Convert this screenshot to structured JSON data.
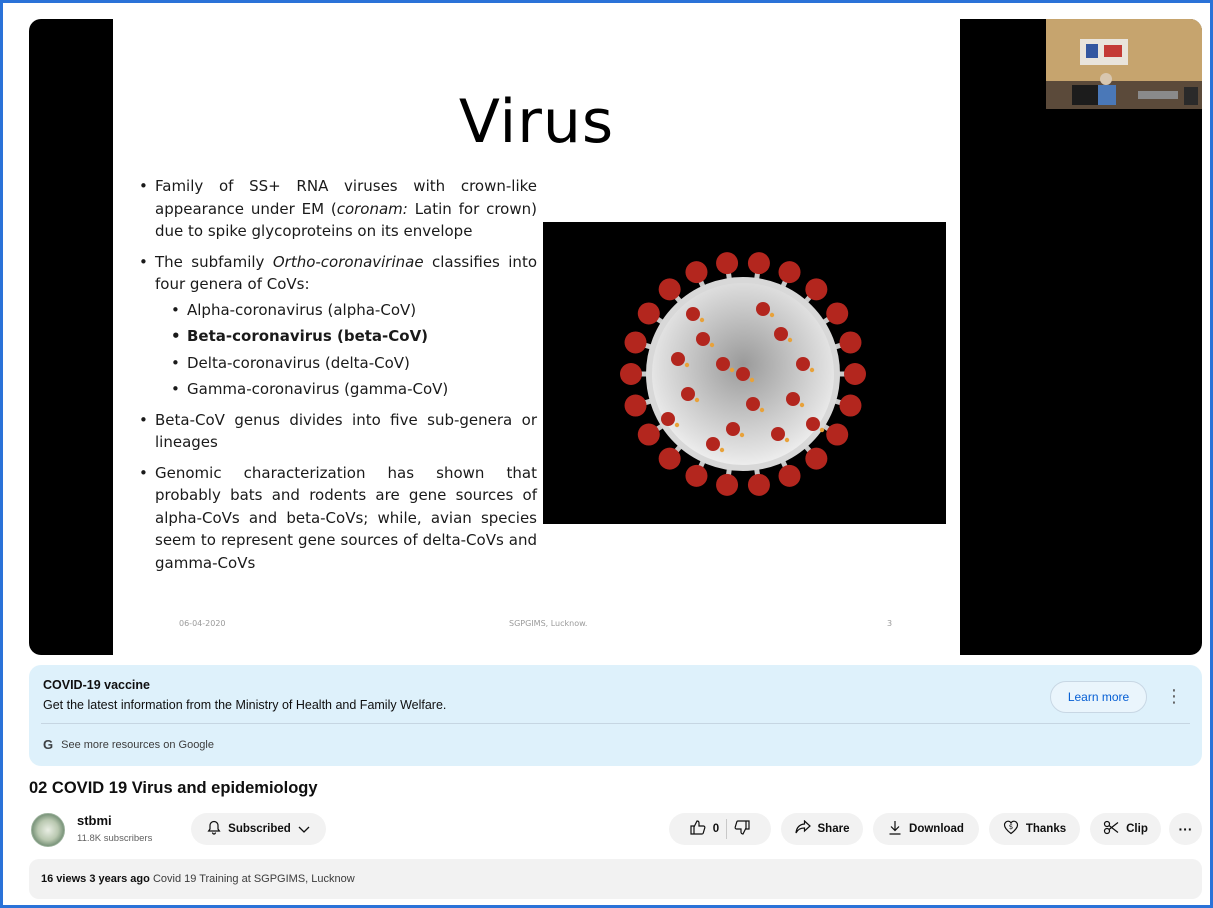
{
  "slide": {
    "title": "Virus",
    "bullets": [
      {
        "pre": "Family of SS+ RNA viruses with crown-like appearance under EM (",
        "em": "coronam:",
        "post": " Latin for crown) due to spike glycoproteins on its envelope"
      },
      {
        "pre": "The subfamily ",
        "em": "Ortho-coronavirinae",
        "post": " classifies into four genera of CoVs:"
      },
      {
        "pre": "Beta-CoV genus divides into five sub-genera or lineages"
      },
      {
        "pre": "Genomic characterization has shown that probably bats and rodents are gene sources of alpha-CoVs and beta-CoVs; while, avian species seem to represent gene sources of delta-CoVs and gamma-CoVs"
      }
    ],
    "sub_bullets": [
      "Alpha-coronavirus (alpha-CoV)",
      "Beta-coronavirus (beta-CoV)",
      "Delta-coronavirus (delta-CoV)",
      "Gamma-coronavirus (gamma-CoV)"
    ],
    "footer_date": "06-04-2020",
    "footer_center": "SGPGIMS, Lucknow.",
    "footer_page": "3"
  },
  "info_panel": {
    "title": "COVID-19 vaccine",
    "description": "Get the latest information from the Ministry of Health and Family Welfare.",
    "learn_more": "Learn more",
    "google_link": "See more resources on Google"
  },
  "video": {
    "title": "02 COVID 19 Virus and epidemiology"
  },
  "channel": {
    "name": "stbmi",
    "subscribers": "11.8K subscribers",
    "subscribed_label": "Subscribed"
  },
  "actions": {
    "like_count": "0",
    "share": "Share",
    "download": "Download",
    "thanks": "Thanks",
    "clip": "Clip"
  },
  "description": {
    "views": "16 views",
    "age": "3 years ago",
    "text": "Covid 19 Training at SGPGIMS, Lucknow"
  },
  "colors": {
    "frame_border": "#2a72d8",
    "info_panel_bg": "#def1fb",
    "link_blue": "#065fd4",
    "virus_spike": "#b3261e"
  }
}
